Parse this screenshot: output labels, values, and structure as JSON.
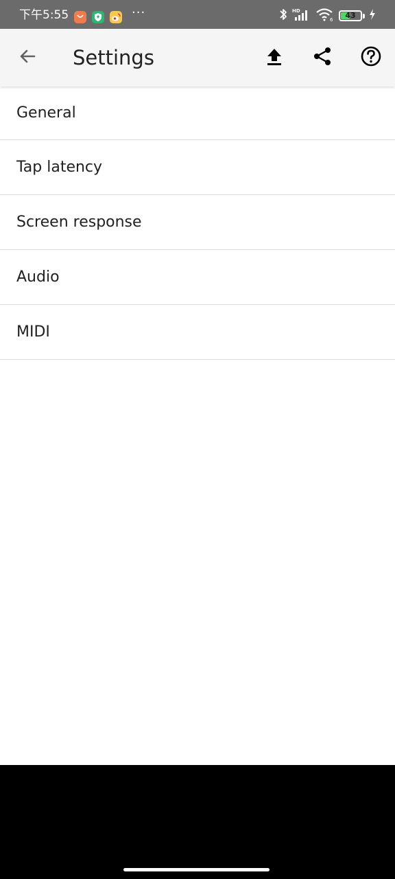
{
  "status_bar": {
    "time": "下午5:55",
    "more_indicator": "···",
    "battery_level": "43",
    "battery_percent": 43,
    "icons": [
      "orange-app-icon",
      "shield-app-icon",
      "weibo-app-icon",
      "bluetooth-icon",
      "hd-signal-icon",
      "wifi-icon",
      "battery-icon",
      "charging-bolt-icon"
    ]
  },
  "app_bar": {
    "title": "Settings",
    "actions": [
      "back-arrow-icon",
      "upload-icon",
      "share-icon",
      "help-icon"
    ]
  },
  "settings": {
    "items": [
      {
        "label": "General"
      },
      {
        "label": "Tap latency"
      },
      {
        "label": "Screen response"
      },
      {
        "label": "Audio"
      },
      {
        "label": "MIDI"
      }
    ]
  },
  "colors": {
    "status_bar": "#6b6b6b",
    "app_bar": "#f5f5f5",
    "divider": "#dcdcdc",
    "text": "#212121",
    "battery_fill": "#4cd964",
    "nav_bar": "#000000"
  }
}
